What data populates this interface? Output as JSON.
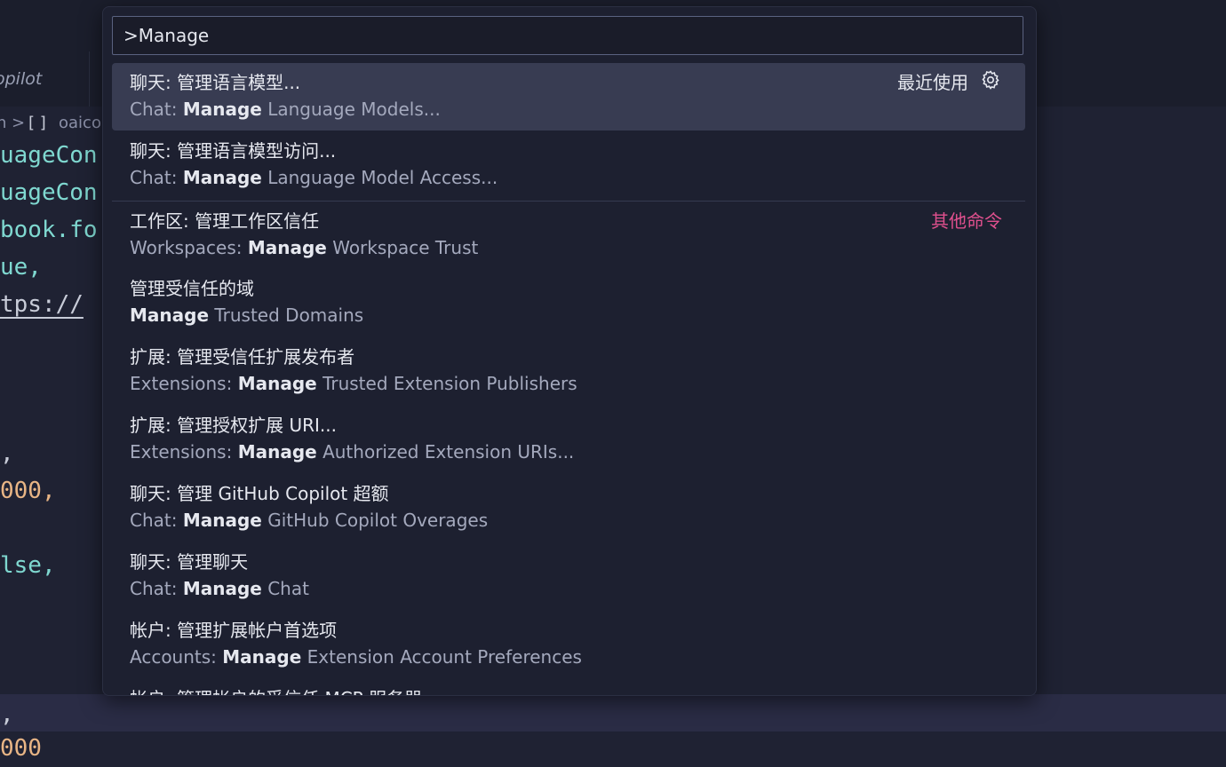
{
  "editor": {
    "tab_label": "opilot",
    "breadcrumb": {
      "sep_prefix": "n",
      "chevron": ">",
      "brackets": "[ ]",
      "name": "oaico"
    },
    "lines": [
      {
        "text": "uageCon",
        "kind": "cyan"
      },
      {
        "text": "uageCon",
        "kind": "cyan"
      },
      {
        "text": "book.fo",
        "kind": "cyan"
      },
      {
        "text": "ue,",
        "kind": "cyan"
      },
      {
        "text": "tps://",
        "kind": "url"
      },
      {
        "text": ",",
        "kind": "plain"
      },
      {
        "text": "000,",
        "kind": "num"
      },
      {
        "text": "lse,",
        "kind": "cyan"
      },
      {
        "text": ",",
        "kind": "plain"
      },
      {
        "text": "000",
        "kind": "num"
      }
    ]
  },
  "quick_pick": {
    "input_value": ">Manage",
    "gear_icon": "gear-icon",
    "accent_color": "#e0508e",
    "items": [
      {
        "label": "聊天: 管理语言模型...",
        "detail_prefix": "Chat: ",
        "detail_match": "Manage",
        "detail_suffix": " Language Models...",
        "meta": "最近使用"
      },
      {
        "label": "聊天: 管理语言模型访问...",
        "detail_prefix": "Chat: ",
        "detail_match": "Manage",
        "detail_suffix": " Language Model Access...",
        "meta": ""
      },
      {
        "label": "工作区: 管理工作区信任",
        "detail_prefix": "Workspaces: ",
        "detail_match": "Manage",
        "detail_suffix": " Workspace Trust",
        "meta": "其他命令"
      },
      {
        "label": "管理受信任的域",
        "detail_prefix": "",
        "detail_match": "Manage",
        "detail_suffix": " Trusted Domains",
        "meta": ""
      },
      {
        "label": "扩展: 管理受信任扩展发布者",
        "detail_prefix": "Extensions: ",
        "detail_match": "Manage",
        "detail_suffix": " Trusted Extension Publishers",
        "meta": ""
      },
      {
        "label": "扩展: 管理授权扩展 URI...",
        "detail_prefix": "Extensions: ",
        "detail_match": "Manage",
        "detail_suffix": " Authorized Extension URIs...",
        "meta": ""
      },
      {
        "label": "聊天: 管理 GitHub Copilot 超额",
        "detail_prefix": "Chat: ",
        "detail_match": "Manage",
        "detail_suffix": " GitHub Copilot Overages",
        "meta": ""
      },
      {
        "label": "聊天: 管理聊天",
        "detail_prefix": "Chat: ",
        "detail_match": "Manage",
        "detail_suffix": " Chat",
        "meta": ""
      },
      {
        "label": "帐户: 管理扩展帐户首选项",
        "detail_prefix": "Accounts: ",
        "detail_match": "Manage",
        "detail_suffix": " Extension Account Preferences",
        "meta": ""
      },
      {
        "label": "帐户: 管理帐户的受信任 MCP 服务器",
        "detail_prefix": "",
        "detail_match": "",
        "detail_suffix": "",
        "meta": ""
      }
    ]
  }
}
